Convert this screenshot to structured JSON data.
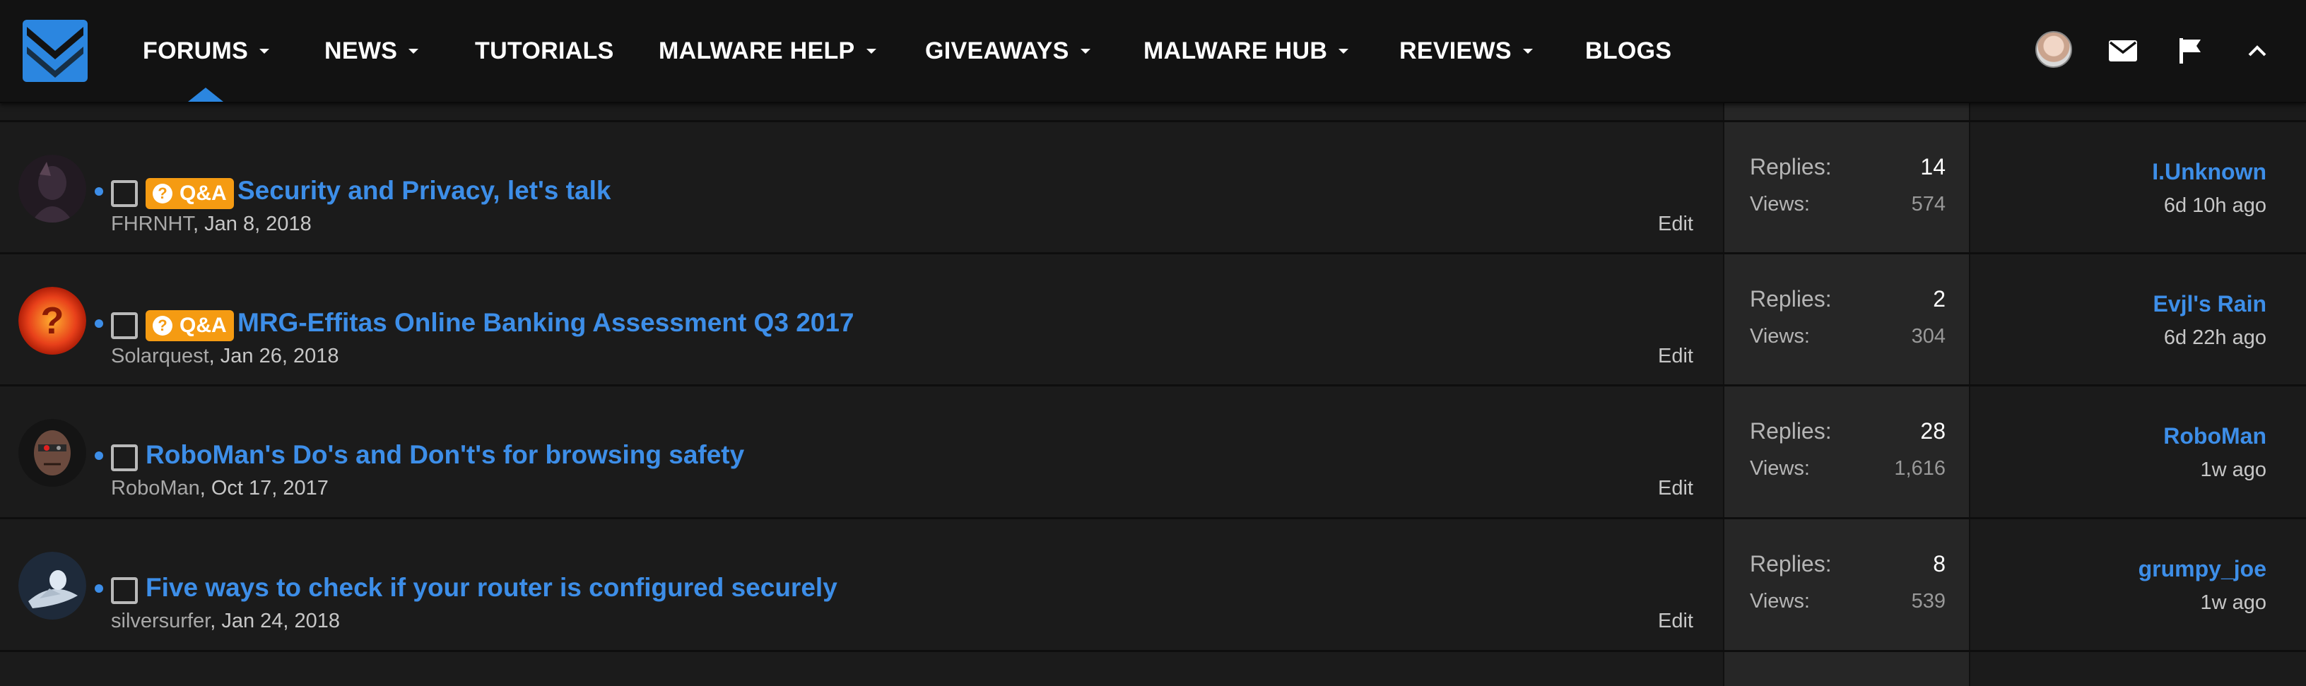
{
  "nav": {
    "items": [
      {
        "label": "FORUMS",
        "has_dropdown": true,
        "active": true
      },
      {
        "label": "NEWS",
        "has_dropdown": true
      },
      {
        "label": "TUTORIALS",
        "has_dropdown": false
      },
      {
        "label": "MALWARE HELP",
        "has_dropdown": true
      },
      {
        "label": "GIVEAWAYS",
        "has_dropdown": true
      },
      {
        "label": "MALWARE HUB",
        "has_dropdown": true
      },
      {
        "label": "REVIEWS",
        "has_dropdown": true
      },
      {
        "label": "BLOGS",
        "has_dropdown": false
      }
    ],
    "right_icons": [
      "user-avatar",
      "envelope-icon",
      "flag-icon",
      "chevron-up-icon"
    ]
  },
  "colors": {
    "accent": "#3d8ee8",
    "badge": "#f59b12",
    "nav_bg": "#121212",
    "page_bg": "#1b1b1b",
    "stats_bg": "#262626"
  },
  "stats_labels": {
    "replies": "Replies:",
    "views": "Views:"
  },
  "edit_label": "Edit",
  "threads": [
    {
      "qa_badge": "Q&A",
      "title": "Security and Privacy, let's talk",
      "author": "FHRNHT",
      "date": "Jan 8, 2018",
      "replies": "14",
      "views": "574",
      "last_poster": "I.Unknown",
      "last_time": "6d 10h ago"
    },
    {
      "qa_badge": "Q&A",
      "title": "MRG-Effitas Online Banking Assessment Q3 2017",
      "author": "Solarquest",
      "date": "Jan 26, 2018",
      "replies": "2",
      "views": "304",
      "last_poster": "Evjl's Rain",
      "last_time": "6d 22h ago"
    },
    {
      "title": "RoboMan's Do's and Don't's for browsing safety",
      "author": "RoboMan",
      "date": "Oct 17, 2017",
      "replies": "28",
      "views": "1,616",
      "last_poster": "RoboMan",
      "last_time": "1w ago"
    },
    {
      "title": "Five ways to check if your router is configured securely",
      "author": "silversurfer",
      "date": "Jan 24, 2018",
      "replies": "8",
      "views": "539",
      "last_poster": "grumpy_joe",
      "last_time": "1w ago"
    }
  ]
}
